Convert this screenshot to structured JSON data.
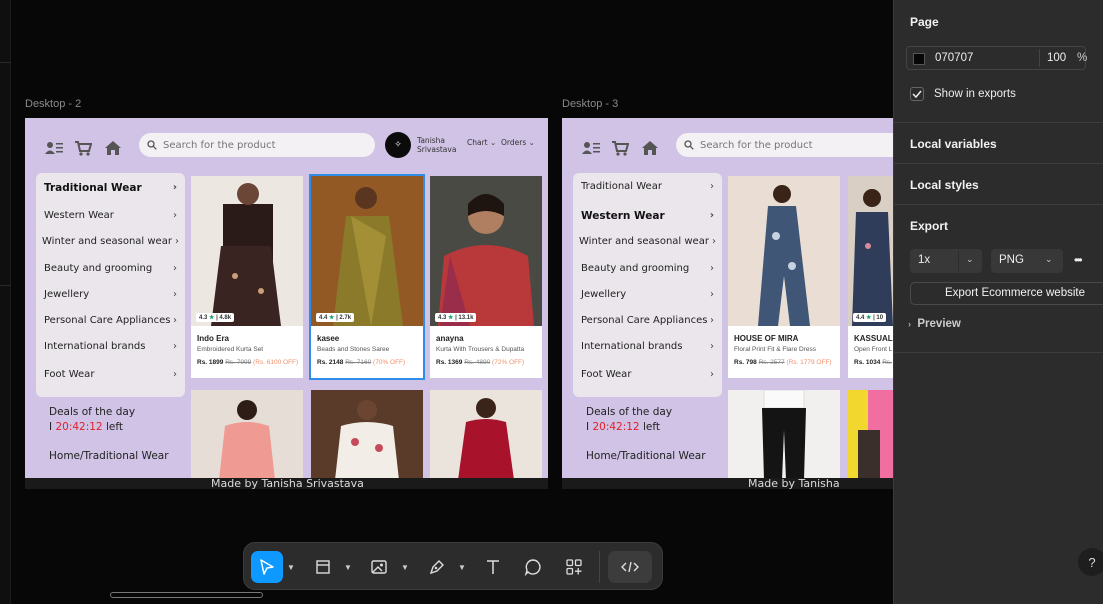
{
  "frames": [
    {
      "label": "Desktop - 2",
      "search_placeholder": "Search for the product",
      "avatar_letter": "✧",
      "user_first": "Tanisha",
      "user_last": "Srivastava",
      "nav_chart": "Chart",
      "nav_orders": "Orders",
      "categories": [
        "Traditional Wear",
        "Western Wear",
        "Winter and seasonal wear",
        "Beauty and grooming",
        "Jewellery",
        "Personal Care Appliances",
        "International brands",
        "Foot Wear"
      ],
      "active_category": "Traditional Wear",
      "deals_title": "Deals of the day",
      "deals_prefix": "I",
      "deals_timer": "20:42:12",
      "deals_suffix": "left",
      "breadcrumb": "Home/Traditional Wear",
      "footer": "Made by Tanisha Srivastava",
      "cards": [
        {
          "rating": "4.3",
          "count": "4.8k",
          "brand": "Indo Era",
          "desc": "Embroidered Kurta Set",
          "price": "Rs. 1899",
          "mrp": "Rs. 7999",
          "off": "(Rs. 6100 OFF)",
          "selected": false
        },
        {
          "rating": "4.4",
          "count": "2.7k",
          "brand": "kasee",
          "desc": "Beads and Stones Saree",
          "price": "Rs. 2148",
          "mrp": "Rs. 7160",
          "off": "(70% OFF)",
          "selected": true
        },
        {
          "rating": "4.3",
          "count": "13.1k",
          "brand": "anayna",
          "desc": "Kurta With Trousers & Dupatta",
          "price": "Rs. 1369",
          "mrp": "Rs. 4890",
          "off": "(72% OFF)",
          "selected": false
        }
      ]
    },
    {
      "label": "Desktop - 3",
      "search_placeholder": "Search for the product",
      "categories": [
        "Traditional Wear",
        "Western Wear",
        "Winter and seasonal wear",
        "Beauty and grooming",
        "Jewellery",
        "Personal Care Appliances",
        "International brands",
        "Foot Wear"
      ],
      "active_category": "Western Wear",
      "deals_title": "Deals of the day",
      "deals_prefix": "I",
      "deals_timer": "20:42:12",
      "deals_suffix": "left",
      "breadcrumb": "Home/Traditional Wear",
      "footer": "Made by Tanisha Srivastava",
      "cards": [
        {
          "rating": "",
          "count": "",
          "brand": "HOUSE OF MIRA",
          "desc": "Floral Print Fit & Flare Dress",
          "price": "Rs. 798",
          "mrp": "Rs. 2577",
          "off": "(Rs. 1779 OFF)",
          "selected": false
        },
        {
          "rating": "4.4",
          "count": "10",
          "brand": "KASSUALLY",
          "desc": "Open Front L",
          "price": "Rs. 1034",
          "mrp": "Rs.",
          "off": "",
          "selected": false
        }
      ]
    }
  ],
  "panel": {
    "page_title": "Page",
    "bg_hex": "070707",
    "bg_opacity": "100",
    "percent": "%",
    "show_exports": "Show in exports",
    "local_variables": "Local variables",
    "local_styles": "Local styles",
    "export_title": "Export",
    "export_scale": "1x",
    "export_format": "PNG",
    "export_more": "•••",
    "export_button": "Export Ecommerce website",
    "preview": "Preview",
    "help": "?"
  },
  "colors": {
    "frame_bg": "#d0c3e6",
    "accent": "#0d99ff",
    "timer": "#e0202a",
    "panel": "#2c2c2c"
  }
}
